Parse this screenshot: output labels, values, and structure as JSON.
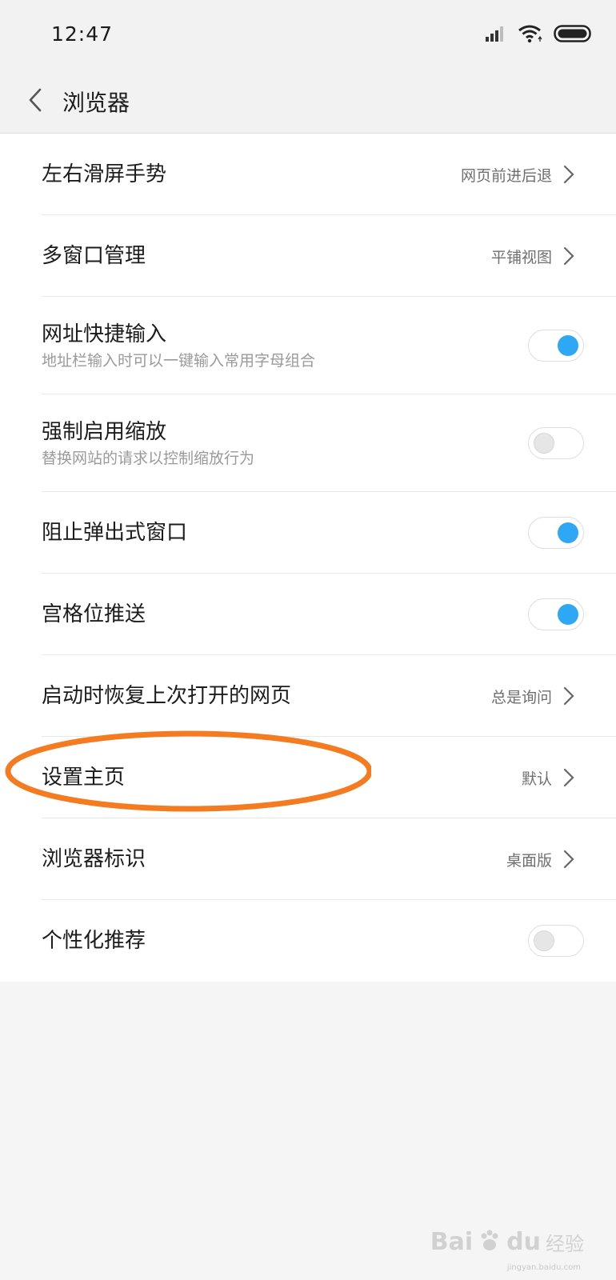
{
  "status_bar": {
    "time": "12:47",
    "icons": [
      "signal-icon",
      "wifi-icon",
      "battery-icon"
    ]
  },
  "header": {
    "back_icon": "chevron-left-icon",
    "title": "浏览器"
  },
  "settings": [
    {
      "title": "左右滑屏手势",
      "value": "网页前进后退"
    },
    {
      "title": "多窗口管理",
      "value": "平铺视图"
    },
    {
      "title": "网址快捷输入",
      "subtitle": "地址栏输入时可以一键输入常用字母组合",
      "toggle_on": true
    },
    {
      "title": "强制启用缩放",
      "subtitle": "替换网站的请求以控制缩放行为",
      "toggle_on": false
    },
    {
      "title": "阻止弹出式窗口",
      "toggle_on": true
    },
    {
      "title": "宫格位推送",
      "toggle_on": true
    },
    {
      "title": "启动时恢复上次打开的网页",
      "value": "总是询问"
    },
    {
      "title": "设置主页",
      "value": "默认"
    },
    {
      "title": "浏览器标识",
      "value": "桌面版"
    },
    {
      "title": "个性化推荐",
      "toggle_on": false
    }
  ],
  "annotation": {
    "color": "#f47b20",
    "highlighted_row": "设置主页"
  },
  "watermark": {
    "brand": "Bai",
    "brand2": "du",
    "cn": "经验",
    "url": "jingyan.baidu.com"
  },
  "colors": {
    "accent": "#2ea7f5",
    "background": "#f5f5f5",
    "list_background": "#ffffff"
  }
}
